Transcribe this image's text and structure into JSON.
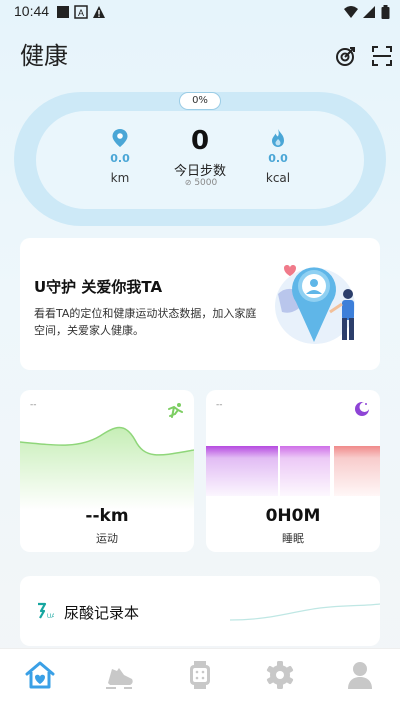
{
  "status_bar": {
    "time": "10:44"
  },
  "header": {
    "title": "健康"
  },
  "summary": {
    "progress_label": "0%",
    "distance": {
      "value": "0.0",
      "unit": "km"
    },
    "steps": {
      "value": "0",
      "label": "今日步数",
      "goal": "5000"
    },
    "calories": {
      "value": "0.0",
      "unit": "kcal"
    }
  },
  "guard_card": {
    "title": "U守护 关爱你我TA",
    "description": "看看TA的定位和健康运动状态数据，加入家庭空间，关爱家人健康。"
  },
  "exercise_card": {
    "small_label": "--",
    "value": "--km",
    "label": "运动"
  },
  "sleep_card": {
    "small_label": "--",
    "value": "0H0M",
    "label": "睡眠"
  },
  "uric_card": {
    "badge": "UA",
    "title": "尿酸记录本"
  },
  "colors": {
    "accent": "#3aa0e6",
    "ring": "#cde9f7",
    "exercise": "#8fd67a",
    "sleep_deep": "#a52fd6",
    "sleep_awake": "#f07a7a"
  },
  "tabs": [
    {
      "name": "home",
      "icon": "home-heart-icon"
    },
    {
      "name": "sport",
      "icon": "sneaker-icon"
    },
    {
      "name": "device",
      "icon": "watch-icon"
    },
    {
      "name": "settings",
      "icon": "gear-icon"
    },
    {
      "name": "profile",
      "icon": "person-icon"
    }
  ]
}
